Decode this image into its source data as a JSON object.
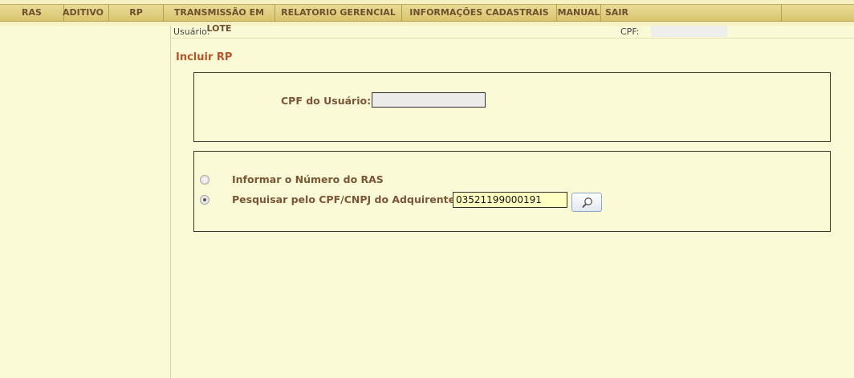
{
  "menu": {
    "items": [
      {
        "label": "RAS"
      },
      {
        "label": "ADITIVO"
      },
      {
        "label": "RP"
      },
      {
        "label": "TRANSMISSÃO EM LOTE"
      },
      {
        "label": "RELATORIO GERENCIAL"
      },
      {
        "label": "INFORMAÇÕES CADASTRAIS"
      },
      {
        "label": "MANUAL"
      },
      {
        "label": "SAIR"
      }
    ]
  },
  "infobar": {
    "user_label": "Usuário:",
    "cpf_label": "CPF:"
  },
  "page": {
    "title": "Incluir RP"
  },
  "cpf_panel": {
    "label": "CPF do Usuário:",
    "value": ""
  },
  "search_panel": {
    "option_ras_label": "Informar o Número do RAS",
    "option_cnpj_label": "Pesquisar pelo CPF/CNPJ do Adquirente",
    "selected_option": "cnpj",
    "cnpj_value": "03521199000191"
  },
  "icons": {
    "search_button": "magnifier-icon"
  }
}
